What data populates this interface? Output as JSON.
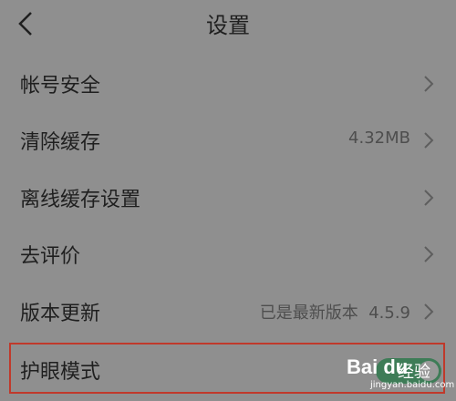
{
  "header": {
    "title": "设置",
    "back_icon": "chevron-left-icon"
  },
  "settings": {
    "items": [
      {
        "label": "帐号安全",
        "value": ""
      },
      {
        "label": "清除缓存",
        "value": "4.32MB"
      },
      {
        "label": "离线缓存设置",
        "value": ""
      },
      {
        "label": "去评价",
        "value": ""
      },
      {
        "label": "版本更新",
        "value": "已是最新版本  4.5.9"
      },
      {
        "label": "护眼模式",
        "toggle_on": true
      }
    ]
  },
  "watermark": {
    "brand": "Bai du",
    "text": "经验",
    "url": "jingyan.baidu.com"
  },
  "colors": {
    "background": "#8f8f8f",
    "text": "#1f1f1f",
    "highlight_border": "#c0392b",
    "toggle_on": "#3e7c57"
  }
}
